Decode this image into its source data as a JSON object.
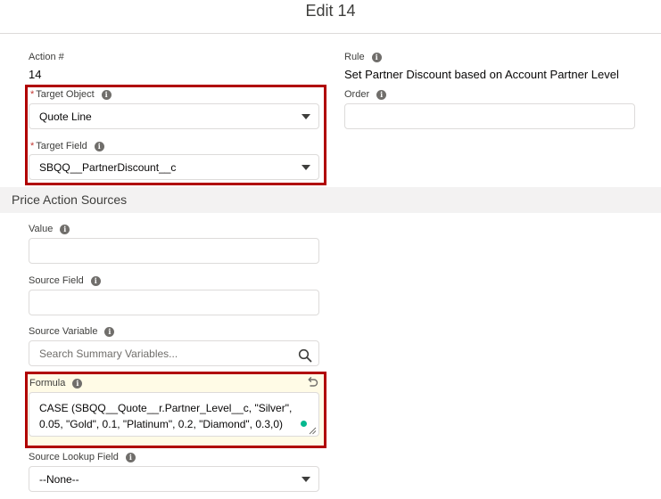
{
  "modal": {
    "title": "Edit 14"
  },
  "fields": {
    "action_number": {
      "label": "Action #",
      "value": "14"
    },
    "rule": {
      "label": "Rule",
      "value": "Set Partner Discount based on Account Partner Level"
    },
    "target_object": {
      "label": "Target Object",
      "required": "*",
      "value": "Quote Line"
    },
    "order": {
      "label": "Order",
      "value": ""
    },
    "target_field": {
      "label": "Target Field",
      "required": "*",
      "value": "SBQQ__PartnerDiscount__c"
    }
  },
  "section": {
    "title": "Price Action Sources"
  },
  "sources": {
    "value": {
      "label": "Value",
      "value": ""
    },
    "source_field": {
      "label": "Source Field",
      "value": ""
    },
    "source_variable": {
      "label": "Source Variable",
      "placeholder": "Search Summary Variables..."
    },
    "formula": {
      "label": "Formula",
      "value_line1": "CASE (SBQQ__Quote__r.Partner_Level__c, \"Silver\",",
      "value_line2": "0.05, \"Gold\", 0.1, \"Platinum\", 0.2, \"Diamond\", 0.3,0)"
    },
    "source_lookup_field": {
      "label": "Source Lookup Field",
      "value": "--None--"
    }
  },
  "icons": {
    "info": "info-icon",
    "search": "search-icon",
    "undo": "undo-icon",
    "dropdown": "chevron-down-icon"
  },
  "colors": {
    "highlight": "#b00000",
    "accent_dot": "#04b88f",
    "section_bg": "#f3f2f2"
  }
}
